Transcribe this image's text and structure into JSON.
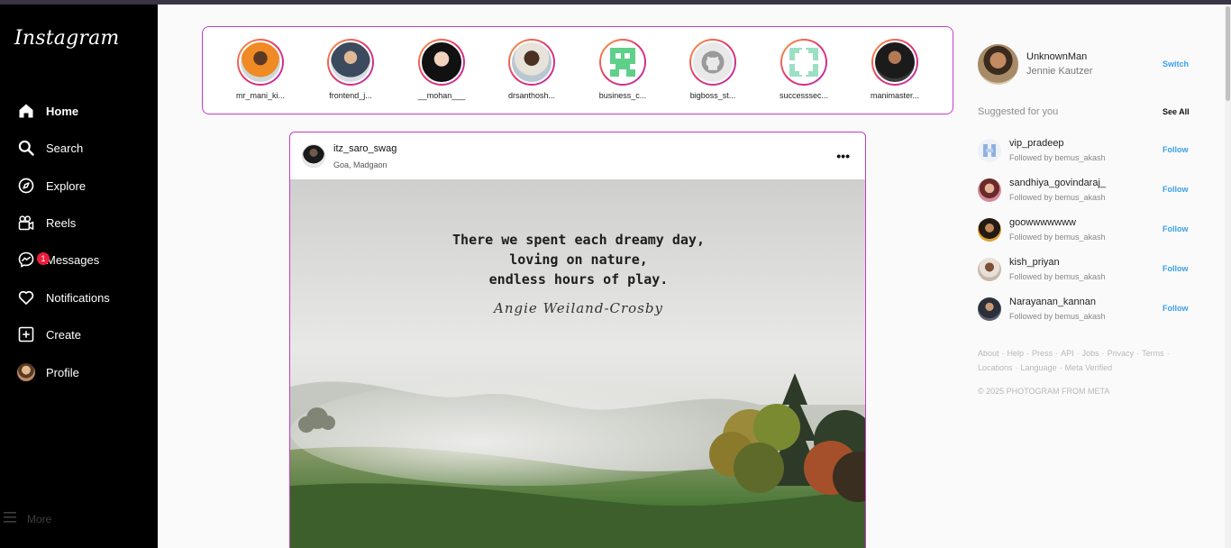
{
  "sidebar": {
    "logo": "Instagram",
    "items": [
      {
        "label": "Home",
        "icon": "home-icon"
      },
      {
        "label": "Search",
        "icon": "search-icon"
      },
      {
        "label": "Explore",
        "icon": "compass-icon"
      },
      {
        "label": "Reels",
        "icon": "reels-icon"
      },
      {
        "label": "Messages",
        "icon": "messenger-icon",
        "badge": "1"
      },
      {
        "label": "Notifications",
        "icon": "heart-icon"
      },
      {
        "label": "Create",
        "icon": "plus-square-icon"
      },
      {
        "label": "Profile",
        "icon": "avatar"
      }
    ],
    "more_label": "More"
  },
  "stories": [
    {
      "name": "mr_mani_ki..."
    },
    {
      "name": "frontend_j..."
    },
    {
      "name": "__mohan___"
    },
    {
      "name": "drsanthosh..."
    },
    {
      "name": "business_c..."
    },
    {
      "name": "bigboss_st..."
    },
    {
      "name": "successsec..."
    },
    {
      "name": "manimaster..."
    }
  ],
  "post": {
    "username": "itz_saro_swag",
    "location": "Goa, Madgaon",
    "quote_lines": [
      "There we spent each dreamy day,",
      "loving on nature,",
      "endless hours of play."
    ],
    "author": "Angie Weiland-Crosby"
  },
  "me": {
    "username": "UnknownMan",
    "name": "Jennie Kautzer",
    "switch_label": "Switch"
  },
  "suggestions": {
    "title": "Suggested for you",
    "see_all": "See All",
    "items": [
      {
        "username": "vip_pradeep",
        "followed_by": "Followed by bemus_akash",
        "action": "Follow"
      },
      {
        "username": "sandhiya_govindaraj_",
        "followed_by": "Followed by bemus_akash",
        "action": "Follow"
      },
      {
        "username": "goowwwwwww",
        "followed_by": "Followed by bemus_akash",
        "action": "Follow"
      },
      {
        "username": "kish_priyan",
        "followed_by": "Followed by bemus_akash",
        "action": "Follow"
      },
      {
        "username": "Narayanan_kannan",
        "followed_by": "Followed by bemus_akash",
        "action": "Follow"
      }
    ]
  },
  "footer": {
    "links_row1": [
      "About",
      "Help",
      "Press",
      "API",
      "Jobs",
      "Privacy",
      "Terms"
    ],
    "links_row2": [
      "Locations",
      "Language",
      "Meta Verified"
    ],
    "copyright": "© 2025 PHOTOGRAM FROM META"
  },
  "colors": {
    "accent_border": "#c23fc4",
    "follow_blue": "#3aa0e8",
    "badge_red": "#ed1c3c"
  }
}
